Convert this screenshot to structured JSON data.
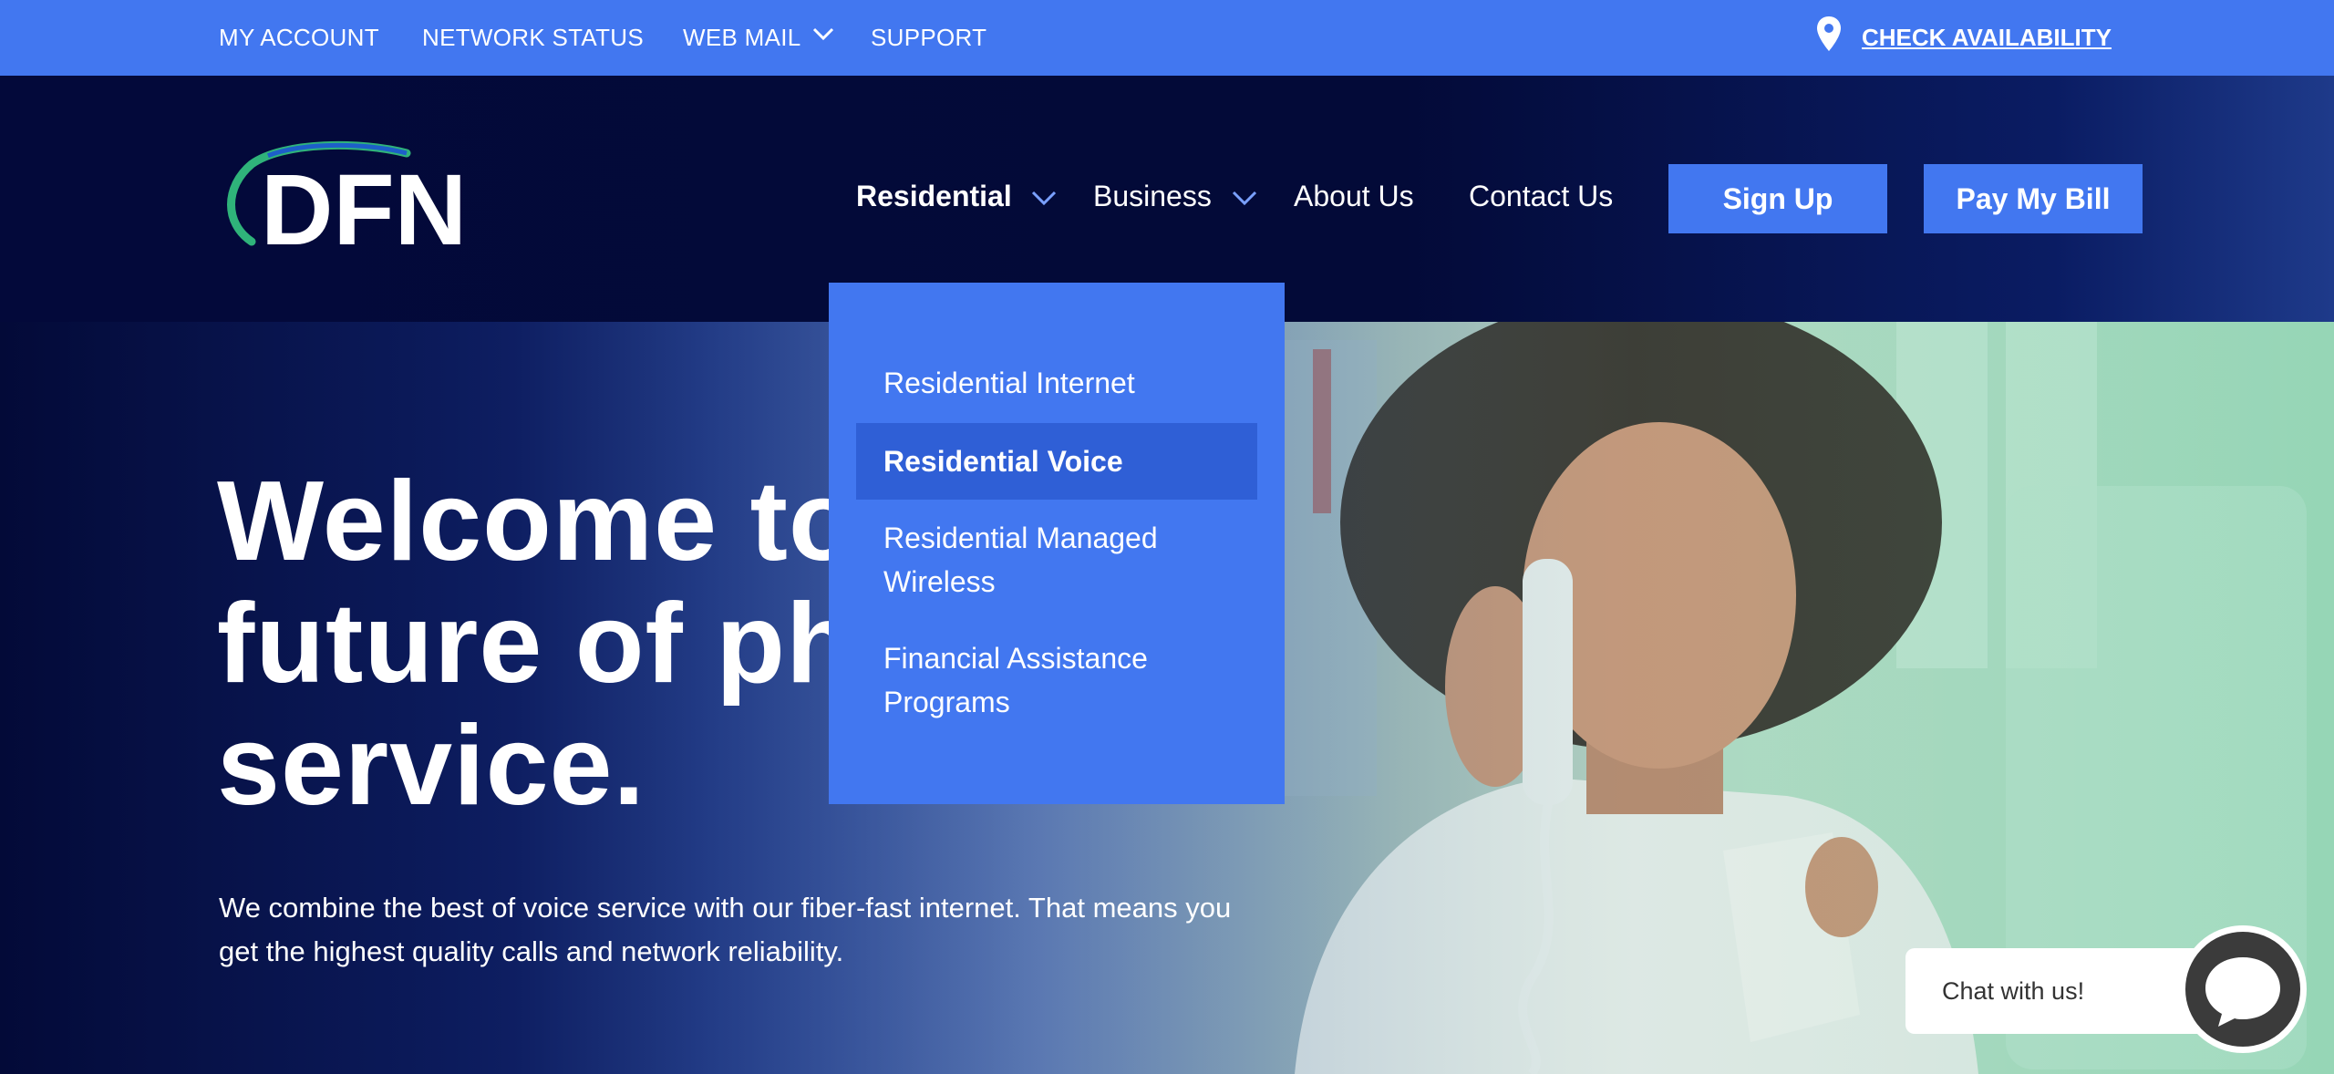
{
  "topbar": {
    "links": [
      "MY ACCOUNT",
      "NETWORK STATUS",
      "WEB MAIL",
      "SUPPORT"
    ],
    "check_availability": "CHECK AVAILABILITY"
  },
  "header": {
    "logo_text": "DFN",
    "nav": [
      "Residential",
      "Business",
      "About Us",
      "Contact Us"
    ],
    "sign_up": "Sign Up",
    "pay_bill": "Pay My Bill"
  },
  "dropdown": {
    "items": [
      "Residential Internet",
      "Residential Voice",
      "Residential Managed Wireless",
      "Financial Assistance Programs"
    ],
    "active_item": "Residential Voice"
  },
  "hero": {
    "title_lines": [
      "Welcome to",
      "future of ph",
      "service."
    ],
    "subtitle": "We combine the best of voice service with our fiber-fast internet. That means you get the highest quality calls and network reliability."
  },
  "chat": {
    "label": "Chat with us!"
  },
  "colors": {
    "accent": "#4277f0",
    "navy": "#030a38",
    "dropdown_active": "#2f5fd6"
  }
}
